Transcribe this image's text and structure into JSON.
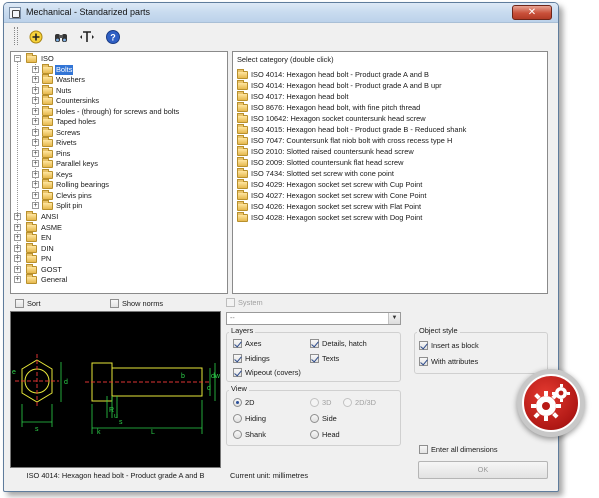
{
  "window": {
    "title": "Mechanical - Standarized parts",
    "close_label": "✕"
  },
  "toolbar": {
    "buttons": [
      "add-icon",
      "binoculars-icon",
      "text-ruler-icon",
      "help-icon"
    ]
  },
  "tree": {
    "root": "ISO",
    "children": [
      "Bolts",
      "Washers",
      "Nuts",
      "Countersinks",
      "Holes - (through) for screws and bolts",
      "Taped holes",
      "Screws",
      "Rivets",
      "Pins",
      "Parallel keys",
      "Keys",
      "Rolling bearings",
      "Clevis pins",
      "Split pin"
    ],
    "others": [
      "ANSI",
      "ASME",
      "EN",
      "DIN",
      "PN",
      "GOST",
      "General"
    ],
    "selected": "Bolts"
  },
  "catalog": {
    "header": "Select category (double click)",
    "items": [
      "ISO 4014: Hexagon head bolt - Product grade A and B",
      "ISO 4014: Hexagon head bolt - Product grade A and B upr",
      "ISO 4017: Hexagon head bolt",
      "ISO 8676: Hexagon head bolt, with fine pitch thread",
      "ISO 10642: Hexagon socket countersunk head screw",
      "ISO 4015: Hexagon head bolt - Product grade B - Reduced shank",
      "ISO 7047: Countersunk flat niob bolt with cross recess type H",
      "ISO 2010: Slotted raised countersunk head screw",
      "ISO 2009: Slotted countersunk flat head screw",
      "ISO 7434: Slotted set screw with cone point",
      "ISO 4029: Hexagon socket set screw with Cup Point",
      "ISO 4027: Hexagon socket set screw with Cone Point",
      "ISO 4026: Hexagon socket set screw with Flat Point",
      "ISO 4028: Hexagon socket set screw with Dog Point"
    ]
  },
  "options": {
    "sort_label": "Sort",
    "show_norms_label": "Show norms",
    "system_label": "System",
    "combo_value": "--"
  },
  "layers": {
    "title": "Layers",
    "axes": "Axes",
    "details_hatch": "Details, hatch",
    "hidings": "Hidings",
    "texts": "Texts",
    "wipeout": "Wipeout (covers)"
  },
  "view": {
    "title": "View",
    "v2d": "2D",
    "v3d": "3D",
    "v2d3d": "2D/3D",
    "hiding": "Hiding",
    "side": "Side",
    "shank": "Shank",
    "head": "Head"
  },
  "object_style": {
    "title": "Object style",
    "insert_block": "Insert as block",
    "with_attributes": "With attributes"
  },
  "preview": {
    "caption": "ISO 4014: Hexagon head bolt - Product grade A and B",
    "dims": [
      "e",
      "d",
      "b",
      "dw",
      "d",
      "k",
      "s",
      "L",
      "R",
      "u",
      "s"
    ]
  },
  "footer": {
    "current_unit": "Current unit: millimetres",
    "enter_all_dimensions": "Enter all dimensions",
    "ok": "OK"
  },
  "colors": {
    "selection": "#3275d6",
    "badge": "#c0201c"
  }
}
